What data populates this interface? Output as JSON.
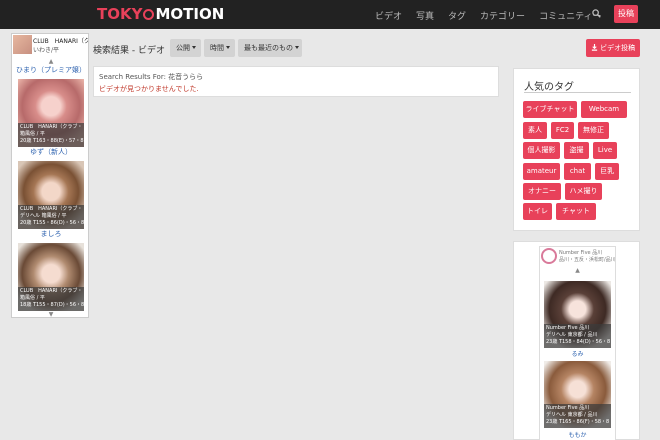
{
  "nav": {
    "logo_part1": "TOKY",
    "logo_part2": "MOTION",
    "links": [
      "ビデオ",
      "写真",
      "タグ",
      "カテゴリー",
      "コミュニティー"
    ],
    "post_label": "投稿",
    "search_icon": "search-icon"
  },
  "left_ad": {
    "header_line1": "CLUB　HANARI（クラブ",
    "header_line2": "いわき/平",
    "first_name": "ひまり（プレミア嬢）",
    "cards": [
      {
        "caption1": "CLUB　HANARI（クラブ・",
        "caption2": "箱風俗 / 平",
        "caption3": "20歳 T163・88(E)・57・8",
        "name": "ゆず（新人）"
      },
      {
        "caption1": "CLUB　HANARI（クラブ・",
        "caption2": "デリヘル 箱風俗 / 平",
        "caption3": "20歳 T155・86(D)・56・8",
        "name": "ましろ"
      },
      {
        "caption1": "CLUB　HANARI（クラブ・",
        "caption2": "箱風俗 / 平",
        "caption3": "18歳 T155・87(D)・56・8",
        "name": ""
      }
    ],
    "scroll_up": "▲",
    "scroll_down": "▼"
  },
  "search": {
    "title": "検索結果 - ビデオ",
    "filters": [
      "公開",
      "時間",
      "最も最近のもの"
    ],
    "upload_label": "ビデオ投稿",
    "results_for": "Search Results For: 花音うらら",
    "not_found": "ビデオが見つかりませんでした."
  },
  "tags": {
    "title": "人気のタグ",
    "items": [
      "ライブチャット",
      "Webcam",
      "素人",
      "FC2",
      "無修正",
      "個人撮影",
      "盗撮",
      "Live",
      "amateur",
      "chat",
      "巨乳",
      "オナニー",
      "ハメ撮り",
      "トイレ",
      "チャット"
    ]
  },
  "right_ad": {
    "line1": "Number Five 品川",
    "line2": "品川・五反・浜松町/品川",
    "scroll_up": "▲",
    "cards": [
      {
        "caption1": "Number Five 品川",
        "caption2": "デリヘル 東京都 / 品川",
        "caption3": "23歳 T158・84(D)・56・8",
        "name": "るみ"
      },
      {
        "caption1": "Number Five 品川",
        "caption2": "デリヘル 東京都 / 品川",
        "caption3": "23歳 T165・86(F)・58・8",
        "name": "ももか"
      }
    ]
  },
  "colors": {
    "accent": "#e8415a",
    "navbar": "#222222",
    "background": "#e8e8e8",
    "link": "#3064b0",
    "error": "#c0392b"
  }
}
